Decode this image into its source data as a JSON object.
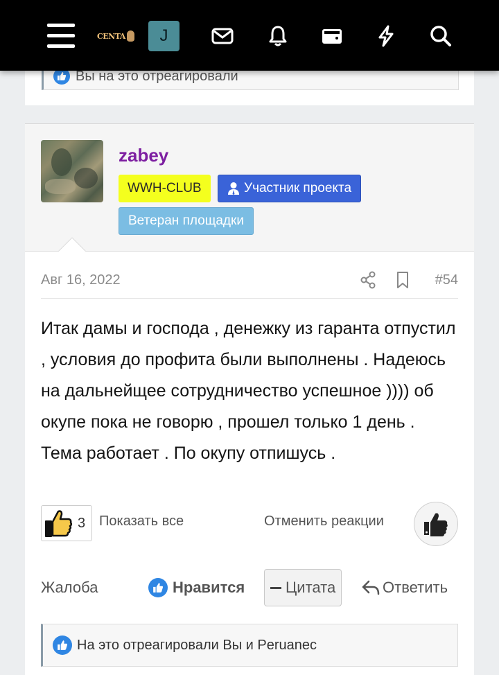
{
  "topbar": {
    "menu_icon": "hamburger-menu-icon",
    "logo_text": "CENTA",
    "avatar_letter": "J",
    "icons": [
      "mail-icon",
      "bell-icon",
      "wallet-icon",
      "lightning-icon",
      "search-icon"
    ]
  },
  "previous_post": {
    "reacted_text": "Вы на это отреагировали"
  },
  "post": {
    "author": {
      "username": "zabey",
      "username_color": "#7d1fa1",
      "badges": [
        {
          "label": "WWH-CLUB",
          "color": "#f4ff1e"
        },
        {
          "label": "Участник проекта",
          "color": "#3a63d8"
        },
        {
          "label": "Ветеран площадки",
          "color": "#7bbde3"
        }
      ]
    },
    "date": "Авг 16, 2022",
    "number": "#54",
    "body": "Итак дамы и господа , денежку из гаранта отпустил , условия до профита были выполнены . Надеюсь на дальнейщее сотрудничество успешное )))) об окупе пока не говорю , прошел только 1 день . Тема работает . По окупу отпишусь .",
    "reactions": {
      "count": "3",
      "show_all": "Показать все",
      "cancel": "Отменить реакции"
    },
    "actions": {
      "report": "Жалоба",
      "like": "Нравится",
      "quote": "Цитата",
      "reply": "Ответить"
    },
    "reacted_text": "На это отреагировали Вы и Peruanec"
  }
}
